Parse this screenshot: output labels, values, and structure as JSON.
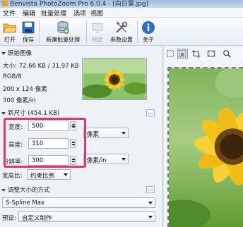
{
  "window": {
    "title": "Benvista PhotoZoom Pro 6.0.4 - [向日葵.jpg]"
  },
  "menu": [
    "文件",
    "编辑",
    "批量处理",
    "选项",
    "视图"
  ],
  "toolbar": {
    "open": "打开",
    "save": "保存",
    "new_batch": "新建批量处理",
    "preview": "预览",
    "settings": "参数设置",
    "about": "关于"
  },
  "original": {
    "heading": "原始图像",
    "size": "大小: 72.66 KB / 31.97 KB",
    "mode": "RGB/8",
    "dims": "200 x 124 像素",
    "res": "300 像素/in"
  },
  "new_size": {
    "heading": "新尺寸 (454.1 KB)",
    "width_label": "宽度:",
    "width_value": "500",
    "height_label": "高度:",
    "height_value": "310",
    "res_label": "分辨率:",
    "res_value": "300",
    "unit": "像素",
    "res_unit": "像素/in",
    "aspect_label": "宽高比:",
    "aspect_value": "约束比例"
  },
  "resize_method": {
    "heading": "调整大小的方式",
    "method": "S-Spline Max",
    "preset_label": "预设:",
    "preset_value": "自定义制作"
  },
  "colors": {
    "highlight": "#e8356f",
    "petal": "#f5c21a",
    "leaf": "#5f9c2e"
  }
}
